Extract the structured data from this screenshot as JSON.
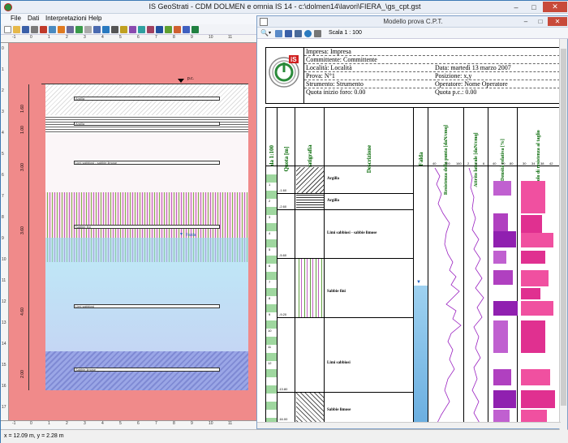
{
  "main_window": {
    "title": "IS GeoStrati - CDM DOLMEN e omnia IS 14 - c:\\dolmen14\\lavori\\FIERA_\\gs_cpt.gst",
    "menu": [
      "File",
      "Dati",
      "Interpretazioni",
      "Help"
    ],
    "status": "x = 12.09 m, y = 2.28 m"
  },
  "ruler": {
    "top_ticks": [
      "-1",
      "0",
      "1",
      "2",
      "3",
      "4",
      "5",
      "6",
      "7",
      "8",
      "9",
      "10",
      "11"
    ],
    "left_ticks": [
      "0",
      "1",
      "2",
      "3",
      "4",
      "5",
      "6",
      "7",
      "8",
      "9",
      "10",
      "11",
      "12",
      "13",
      "14",
      "15",
      "16",
      "17"
    ]
  },
  "section": {
    "pc_label": "p.c.",
    "falda_label": "Falda",
    "layers": [
      {
        "label": "Argilla",
        "thickness": "1.60"
      },
      {
        "label": "Argilla",
        "thickness": "1.00"
      },
      {
        "label": "Limi sabbiosi - sabbie limose",
        "thickness": "3.00"
      },
      {
        "label": "Sabbie fini",
        "thickness": "3.60"
      },
      {
        "label": "Limi sabbiosi",
        "thickness": "4.60"
      },
      {
        "label": "Sabbie limose",
        "thickness": "2.00"
      }
    ]
  },
  "cpt_window": {
    "title": "Modello prova C.P.T.",
    "scale": "Scala 1 : 100",
    "header": {
      "impresa": "Impresa: Impresa",
      "committente": "Committente: Committente",
      "localita": "Località: Località",
      "data": "Data: martedì 13 marzo 2007",
      "prova": "Prova: N°1",
      "posizione": "Posizione: x,y",
      "strumento": "Strumento: Strumento",
      "operatore": "Operatore: Nome Operatore",
      "quota_inizio": "Quota inizio foro: 0.00",
      "quota_pc": "Quota p.c.: 0.00"
    },
    "columns": [
      "Scala 1:100",
      "Quota [m]",
      "Stratigrafia",
      "Descrizione",
      "Falda",
      "Resistenza della punta [daN/cmq]",
      "Attrito laterale [daN/cmq]",
      "Densità relativa [%]",
      "Angolo di resistenza al taglio"
    ],
    "depth_ticks": [
      "1",
      "2",
      "3",
      "4",
      "5",
      "6",
      "7",
      "8",
      "9",
      "10",
      "11",
      "12",
      "13",
      "14",
      "15"
    ],
    "layers": [
      {
        "name": "Argilla",
        "quota_bottom": "-1.60"
      },
      {
        "name": "Argilla",
        "quota_bottom": "-2.60"
      },
      {
        "name": "Limi sabbiosi - sabbie limose",
        "quota_bottom": "-5.60"
      },
      {
        "name": "Sabbie fini",
        "quota_bottom": "-9.20"
      },
      {
        "name": "Limi sabbiosi",
        "quota_bottom": "-13.80"
      },
      {
        "name": "Sabbie limose",
        "quota_bottom": "-16.00"
      }
    ],
    "res_ticks": [
      "40",
      "120",
      "160"
    ],
    "attr_ticks": [
      "2",
      "4",
      "6"
    ],
    "dens_ticks": [
      "40",
      "60",
      "80"
    ],
    "ang_ticks": [
      "30",
      "34",
      "38",
      "42"
    ]
  }
}
